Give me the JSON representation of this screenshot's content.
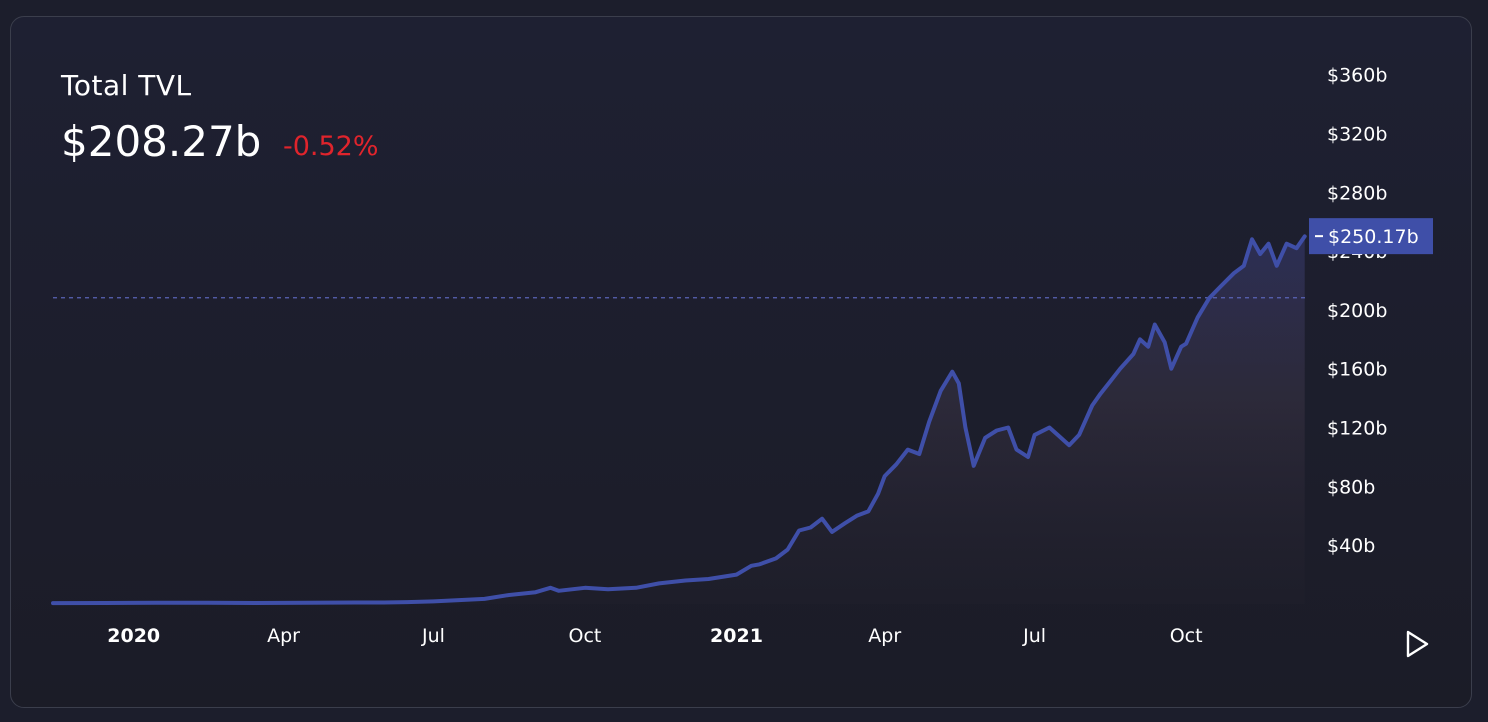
{
  "header": {
    "title": "Total TVL",
    "value": "$208.27b",
    "change": "-0.52%"
  },
  "colors": {
    "line": "#3f4fa8",
    "negative": "#e0242c",
    "price_tag": "#3f4fa8",
    "axis_text": "#ffffff"
  },
  "price_tag_label": "$250.17b",
  "controls": {
    "replay_icon": "play-triangle-icon"
  },
  "chart_data": {
    "type": "area",
    "title": "Total TVL",
    "y_unit": "$b",
    "ylim": [
      0,
      372
    ],
    "y_ticks": [
      {
        "v": 40,
        "label": "$40b"
      },
      {
        "v": 80,
        "label": "$80b"
      },
      {
        "v": 120,
        "label": "$120b"
      },
      {
        "v": 160,
        "label": "$160b"
      },
      {
        "v": 200,
        "label": "$200b"
      },
      {
        "v": 240,
        "label": "$240b"
      },
      {
        "v": 280,
        "label": "$280b"
      },
      {
        "v": 320,
        "label": "$320b"
      },
      {
        "v": 360,
        "label": "$360b"
      }
    ],
    "x_ticks": [
      {
        "date": "2020-01-01",
        "label": "2020",
        "bold": true
      },
      {
        "date": "2020-04-01",
        "label": "Apr",
        "bold": false
      },
      {
        "date": "2020-07-01",
        "label": "Jul",
        "bold": false
      },
      {
        "date": "2020-10-01",
        "label": "Oct",
        "bold": false
      },
      {
        "date": "2021-01-01",
        "label": "2021",
        "bold": true
      },
      {
        "date": "2021-04-01",
        "label": "Apr",
        "bold": false
      },
      {
        "date": "2021-07-01",
        "label": "Jul",
        "bold": false
      },
      {
        "date": "2021-10-01",
        "label": "Oct",
        "bold": false
      }
    ],
    "xlim": [
      "2019-11-13",
      "2021-12-14"
    ],
    "current_value": 208.27,
    "last_value": 250.17,
    "grid": false,
    "series": [
      {
        "points": [
          [
            "2019-11-13",
            0.6
          ],
          [
            "2019-12-15",
            0.7
          ],
          [
            "2020-01-15",
            0.8
          ],
          [
            "2020-02-15",
            0.9
          ],
          [
            "2020-03-15",
            0.7
          ],
          [
            "2020-04-15",
            0.8
          ],
          [
            "2020-05-15",
            1.0
          ],
          [
            "2020-06-01",
            1.0
          ],
          [
            "2020-06-15",
            1.3
          ],
          [
            "2020-07-01",
            1.8
          ],
          [
            "2020-07-15",
            2.5
          ],
          [
            "2020-08-01",
            3.5
          ],
          [
            "2020-08-15",
            6
          ],
          [
            "2020-09-01",
            8
          ],
          [
            "2020-09-10",
            11
          ],
          [
            "2020-09-15",
            9
          ],
          [
            "2020-10-01",
            11
          ],
          [
            "2020-10-15",
            10
          ],
          [
            "2020-11-01",
            11
          ],
          [
            "2020-11-15",
            14
          ],
          [
            "2020-12-01",
            16
          ],
          [
            "2020-12-15",
            17
          ],
          [
            "2021-01-01",
            20
          ],
          [
            "2021-01-10",
            26
          ],
          [
            "2021-01-15",
            27
          ],
          [
            "2021-01-25",
            31
          ],
          [
            "2021-02-01",
            37
          ],
          [
            "2021-02-08",
            50
          ],
          [
            "2021-02-15",
            52
          ],
          [
            "2021-02-22",
            58
          ],
          [
            "2021-02-28",
            49
          ],
          [
            "2021-03-08",
            55
          ],
          [
            "2021-03-15",
            60
          ],
          [
            "2021-03-22",
            63
          ],
          [
            "2021-03-28",
            75
          ],
          [
            "2021-04-01",
            87
          ],
          [
            "2021-04-08",
            95
          ],
          [
            "2021-04-15",
            105
          ],
          [
            "2021-04-22",
            102
          ],
          [
            "2021-04-28",
            124
          ],
          [
            "2021-05-05",
            145
          ],
          [
            "2021-05-12",
            158
          ],
          [
            "2021-05-16",
            150
          ],
          [
            "2021-05-20",
            120
          ],
          [
            "2021-05-25",
            94
          ],
          [
            "2021-06-01",
            113
          ],
          [
            "2021-06-08",
            118
          ],
          [
            "2021-06-15",
            120
          ],
          [
            "2021-06-20",
            105
          ],
          [
            "2021-06-27",
            100
          ],
          [
            "2021-07-01",
            115
          ],
          [
            "2021-07-10",
            120
          ],
          [
            "2021-07-15",
            115
          ],
          [
            "2021-07-22",
            108
          ],
          [
            "2021-07-28",
            115
          ],
          [
            "2021-08-05",
            135
          ],
          [
            "2021-08-10",
            143
          ],
          [
            "2021-08-15",
            150
          ],
          [
            "2021-08-22",
            160
          ],
          [
            "2021-08-30",
            170
          ],
          [
            "2021-09-03",
            180
          ],
          [
            "2021-09-08",
            175
          ],
          [
            "2021-09-12",
            190
          ],
          [
            "2021-09-18",
            178
          ],
          [
            "2021-09-22",
            160
          ],
          [
            "2021-09-28",
            175
          ],
          [
            "2021-10-01",
            177
          ],
          [
            "2021-10-08",
            195
          ],
          [
            "2021-10-15",
            208
          ],
          [
            "2021-10-22",
            216
          ],
          [
            "2021-10-30",
            225
          ],
          [
            "2021-11-05",
            230
          ],
          [
            "2021-11-10",
            248
          ],
          [
            "2021-11-15",
            238
          ],
          [
            "2021-11-20",
            245
          ],
          [
            "2021-11-25",
            230
          ],
          [
            "2021-12-01",
            245
          ],
          [
            "2021-12-07",
            242
          ],
          [
            "2021-12-12",
            250
          ]
        ]
      }
    ]
  }
}
